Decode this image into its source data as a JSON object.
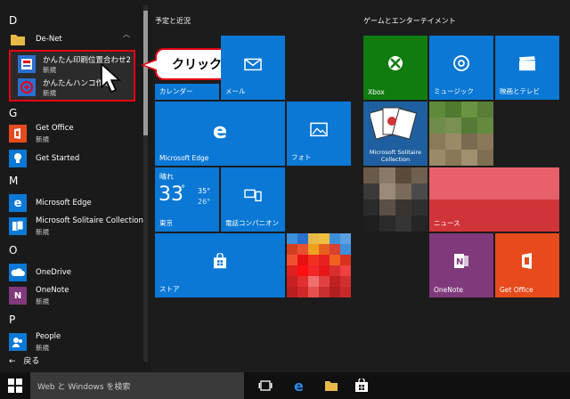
{
  "applist": {
    "letters": [
      "D",
      "G",
      "M",
      "O",
      "P"
    ],
    "denet": {
      "name": "De-Net"
    },
    "kantan1": {
      "name": "かんたん印刷位置合わせ2",
      "sub": "新規"
    },
    "kantan2": {
      "name": "かんたんハンコ作成",
      "sub": "新規"
    },
    "getoffice": {
      "name": "Get Office",
      "sub": "新規"
    },
    "getstarted": {
      "name": "Get Started"
    },
    "edge": {
      "name": "Microsoft Edge"
    },
    "solitaire": {
      "name": "Microsoft Solitaire Collection",
      "sub": "新規"
    },
    "onedrive": {
      "name": "OneDrive"
    },
    "onenote": {
      "name": "OneNote",
      "sub": "新規"
    },
    "people": {
      "name": "People",
      "sub": "新規"
    },
    "back": "戻る"
  },
  "callout": "クリック！",
  "groups": {
    "left": "予定と近況",
    "right": "ゲームとエンターテイメント"
  },
  "tiles": {
    "calendar": "カレンダー",
    "mail": "メール",
    "edge": "Microsoft Edge",
    "photos": "フォト",
    "weather": {
      "condition": "晴れ",
      "temp": "33",
      "deg": "°",
      "high": "35°",
      "low": "26°",
      "city": "東京"
    },
    "phone": "電話コンパニオン",
    "store": "ストア",
    "xbox": "Xbox",
    "groove": "ミュージック",
    "movies": "映画とテレビ",
    "solitaire": "Microsoft Solitaire Collection",
    "news": "ニュース",
    "onenote": "OneNote",
    "getoffice": "Get Office"
  },
  "taskbar": {
    "search_placeholder": "Web と Windows を検索"
  },
  "colors": {
    "accent": "#0a78d4",
    "xbox": "#107c10",
    "news": "#d13438",
    "onenote": "#80397b",
    "office": "#e74a1c",
    "highlight": "#e60012"
  }
}
